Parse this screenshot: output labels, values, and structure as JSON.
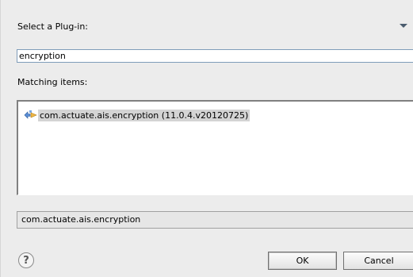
{
  "dialog": {
    "header_label": "Select a Plug-in:",
    "filter_value": "encryption",
    "matching_label": "Matching items:",
    "items": [
      {
        "label": "com.actuate.ais.encryption (11.0.4.v20120725)",
        "icon": "plugin-icon",
        "selected": true
      }
    ],
    "status_text": "com.actuate.ais.encryption",
    "ok_label": "OK",
    "cancel_label": "Cancel",
    "help_glyph": "?"
  },
  "colors": {
    "background": "#ececec",
    "selection": "#d4d4d4",
    "input_border": "#7f9db9"
  }
}
